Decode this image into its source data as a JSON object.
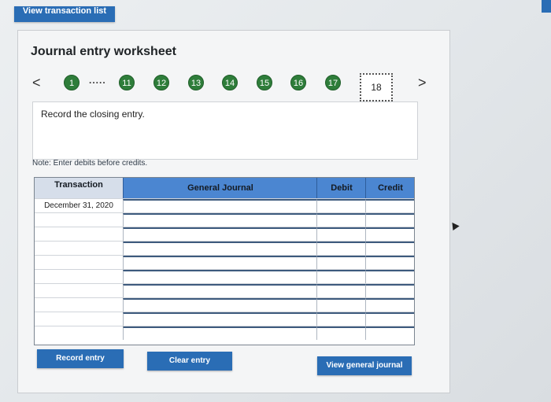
{
  "top": {
    "button_label": "View transaction list"
  },
  "worksheet": {
    "title": "Journal entry worksheet",
    "pager": {
      "prev_icon": "<",
      "next_icon": ">",
      "steps": [
        "1",
        "11",
        "12",
        "13",
        "14",
        "15",
        "16",
        "17"
      ],
      "dots": ".....",
      "current": "18"
    },
    "instruction": "Record the closing entry.",
    "note": "Note: Enter debits before credits.",
    "journal": {
      "headers": {
        "transaction": "Transaction",
        "general_journal": "General Journal",
        "debit": "Debit",
        "credit": "Credit"
      },
      "rows": [
        {
          "transaction": "December 31, 2020"
        },
        {
          "transaction": ""
        },
        {
          "transaction": ""
        },
        {
          "transaction": ""
        },
        {
          "transaction": ""
        },
        {
          "transaction": ""
        },
        {
          "transaction": ""
        },
        {
          "transaction": ""
        },
        {
          "transaction": ""
        },
        {
          "transaction": ""
        }
      ]
    },
    "buttons": {
      "record": "Record entry",
      "clear": "Clear entry",
      "view": "View general journal"
    }
  },
  "colors": {
    "accent": "#2a6db5",
    "step_green": "#2e7d3a",
    "table_header": "#4b86d1"
  }
}
